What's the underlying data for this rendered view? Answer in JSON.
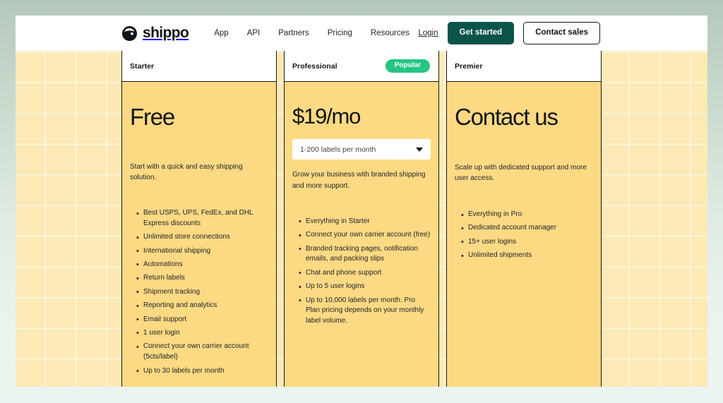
{
  "brand": {
    "name": "shippo",
    "logo_icon": "shippo-logo-icon"
  },
  "nav": {
    "links": [
      {
        "label": "App"
      },
      {
        "label": "API"
      },
      {
        "label": "Partners"
      },
      {
        "label": "Pricing"
      },
      {
        "label": "Resources"
      }
    ],
    "login_label": "Login",
    "get_started_label": "Get started",
    "contact_sales_label": "Contact sales",
    "primary_button_color": "#0b5449"
  },
  "plans": [
    {
      "name": "Starter",
      "badge": null,
      "price": "Free",
      "selector": null,
      "description": "Start with a quick and easy shipping solution.",
      "features": [
        "Best USPS, UPS, FedEx, and DHL Express discounts",
        "Unlimited store connections",
        "International shipping",
        "Automations",
        "Return labels",
        "Shipment tracking",
        "Reporting and analytics",
        "Email support",
        "1 user login",
        "Connect your own carrier account (5cts/label)",
        "Up to 30 labels per month"
      ]
    },
    {
      "name": "Professional",
      "badge": "Popular",
      "badge_color": "#25c583",
      "price": "$19/mo",
      "selector": {
        "value": "1-200 labels per month",
        "caret_icon": "chevron-down-icon"
      },
      "description": "Grow your business with branded shipping and more support.",
      "features": [
        "Everything in Starter",
        "Connect your own carrier account (free)",
        "Branded tracking pages, notification emails, and packing slips",
        "Chat and phone support",
        "Up to 5 user logins",
        "Up to 10,000 labels per month. Pro Plan pricing depends on your monthly label volume."
      ]
    },
    {
      "name": "Premier",
      "badge": null,
      "price": "Contact us",
      "selector": null,
      "description": "Scale up with dedicated support and more user access.",
      "features": [
        "Everything in Pro",
        "Dedicated account manager",
        "15+ user logins",
        "Unlimited shipments"
      ]
    }
  ],
  "theme": {
    "card_body_color": "#fcd983",
    "grid_background_color": "#fce9b5",
    "page_background": "#ffffff",
    "outer_background_top": "#b4c8bb",
    "outer_background_bottom": "#eaf5ef"
  }
}
